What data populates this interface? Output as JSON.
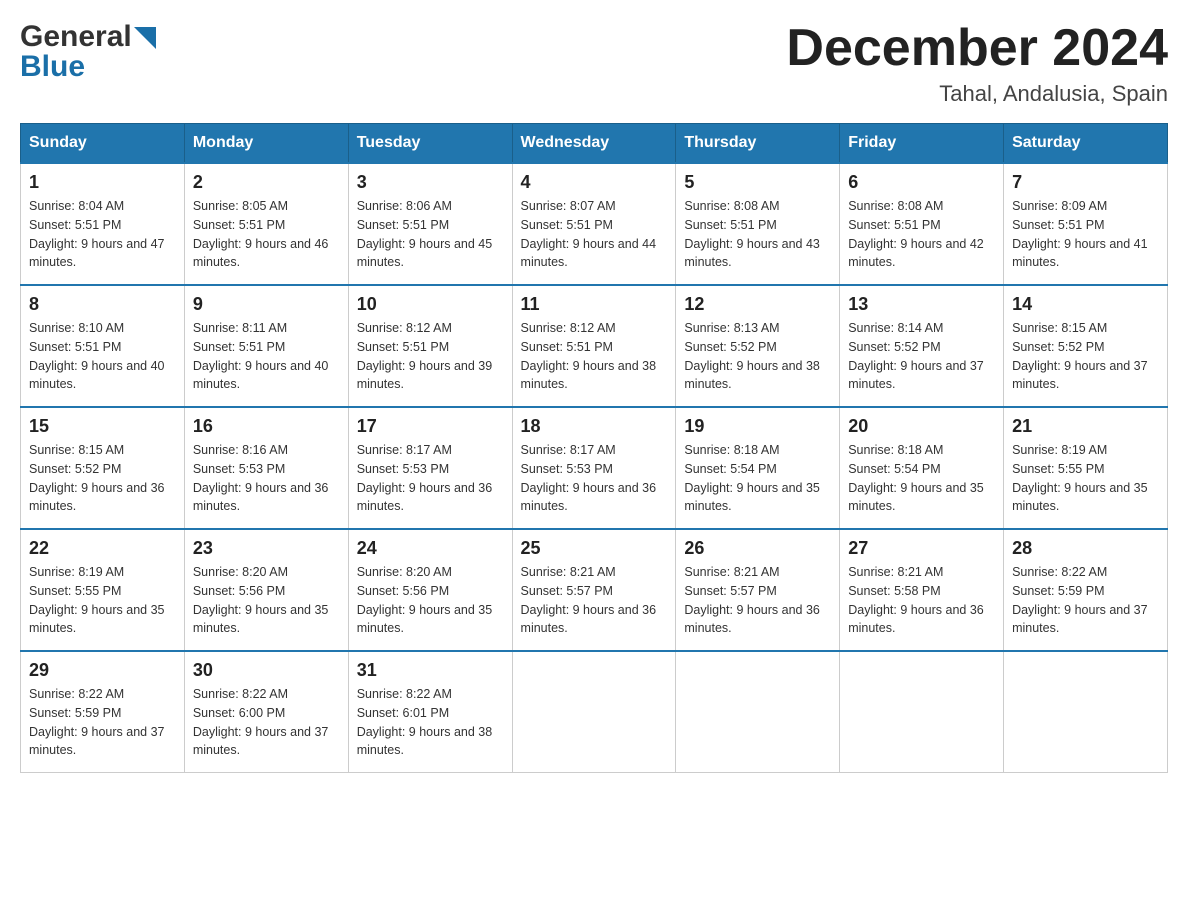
{
  "header": {
    "logo_general": "General",
    "logo_blue": "Blue",
    "month_title": "December 2024",
    "location": "Tahal, Andalusia, Spain"
  },
  "days_of_week": [
    "Sunday",
    "Monday",
    "Tuesday",
    "Wednesday",
    "Thursday",
    "Friday",
    "Saturday"
  ],
  "weeks": [
    [
      {
        "day": "1",
        "sunrise": "Sunrise: 8:04 AM",
        "sunset": "Sunset: 5:51 PM",
        "daylight": "Daylight: 9 hours and 47 minutes."
      },
      {
        "day": "2",
        "sunrise": "Sunrise: 8:05 AM",
        "sunset": "Sunset: 5:51 PM",
        "daylight": "Daylight: 9 hours and 46 minutes."
      },
      {
        "day": "3",
        "sunrise": "Sunrise: 8:06 AM",
        "sunset": "Sunset: 5:51 PM",
        "daylight": "Daylight: 9 hours and 45 minutes."
      },
      {
        "day": "4",
        "sunrise": "Sunrise: 8:07 AM",
        "sunset": "Sunset: 5:51 PM",
        "daylight": "Daylight: 9 hours and 44 minutes."
      },
      {
        "day": "5",
        "sunrise": "Sunrise: 8:08 AM",
        "sunset": "Sunset: 5:51 PM",
        "daylight": "Daylight: 9 hours and 43 minutes."
      },
      {
        "day": "6",
        "sunrise": "Sunrise: 8:08 AM",
        "sunset": "Sunset: 5:51 PM",
        "daylight": "Daylight: 9 hours and 42 minutes."
      },
      {
        "day": "7",
        "sunrise": "Sunrise: 8:09 AM",
        "sunset": "Sunset: 5:51 PM",
        "daylight": "Daylight: 9 hours and 41 minutes."
      }
    ],
    [
      {
        "day": "8",
        "sunrise": "Sunrise: 8:10 AM",
        "sunset": "Sunset: 5:51 PM",
        "daylight": "Daylight: 9 hours and 40 minutes."
      },
      {
        "day": "9",
        "sunrise": "Sunrise: 8:11 AM",
        "sunset": "Sunset: 5:51 PM",
        "daylight": "Daylight: 9 hours and 40 minutes."
      },
      {
        "day": "10",
        "sunrise": "Sunrise: 8:12 AM",
        "sunset": "Sunset: 5:51 PM",
        "daylight": "Daylight: 9 hours and 39 minutes."
      },
      {
        "day": "11",
        "sunrise": "Sunrise: 8:12 AM",
        "sunset": "Sunset: 5:51 PM",
        "daylight": "Daylight: 9 hours and 38 minutes."
      },
      {
        "day": "12",
        "sunrise": "Sunrise: 8:13 AM",
        "sunset": "Sunset: 5:52 PM",
        "daylight": "Daylight: 9 hours and 38 minutes."
      },
      {
        "day": "13",
        "sunrise": "Sunrise: 8:14 AM",
        "sunset": "Sunset: 5:52 PM",
        "daylight": "Daylight: 9 hours and 37 minutes."
      },
      {
        "day": "14",
        "sunrise": "Sunrise: 8:15 AM",
        "sunset": "Sunset: 5:52 PM",
        "daylight": "Daylight: 9 hours and 37 minutes."
      }
    ],
    [
      {
        "day": "15",
        "sunrise": "Sunrise: 8:15 AM",
        "sunset": "Sunset: 5:52 PM",
        "daylight": "Daylight: 9 hours and 36 minutes."
      },
      {
        "day": "16",
        "sunrise": "Sunrise: 8:16 AM",
        "sunset": "Sunset: 5:53 PM",
        "daylight": "Daylight: 9 hours and 36 minutes."
      },
      {
        "day": "17",
        "sunrise": "Sunrise: 8:17 AM",
        "sunset": "Sunset: 5:53 PM",
        "daylight": "Daylight: 9 hours and 36 minutes."
      },
      {
        "day": "18",
        "sunrise": "Sunrise: 8:17 AM",
        "sunset": "Sunset: 5:53 PM",
        "daylight": "Daylight: 9 hours and 36 minutes."
      },
      {
        "day": "19",
        "sunrise": "Sunrise: 8:18 AM",
        "sunset": "Sunset: 5:54 PM",
        "daylight": "Daylight: 9 hours and 35 minutes."
      },
      {
        "day": "20",
        "sunrise": "Sunrise: 8:18 AM",
        "sunset": "Sunset: 5:54 PM",
        "daylight": "Daylight: 9 hours and 35 minutes."
      },
      {
        "day": "21",
        "sunrise": "Sunrise: 8:19 AM",
        "sunset": "Sunset: 5:55 PM",
        "daylight": "Daylight: 9 hours and 35 minutes."
      }
    ],
    [
      {
        "day": "22",
        "sunrise": "Sunrise: 8:19 AM",
        "sunset": "Sunset: 5:55 PM",
        "daylight": "Daylight: 9 hours and 35 minutes."
      },
      {
        "day": "23",
        "sunrise": "Sunrise: 8:20 AM",
        "sunset": "Sunset: 5:56 PM",
        "daylight": "Daylight: 9 hours and 35 minutes."
      },
      {
        "day": "24",
        "sunrise": "Sunrise: 8:20 AM",
        "sunset": "Sunset: 5:56 PM",
        "daylight": "Daylight: 9 hours and 35 minutes."
      },
      {
        "day": "25",
        "sunrise": "Sunrise: 8:21 AM",
        "sunset": "Sunset: 5:57 PM",
        "daylight": "Daylight: 9 hours and 36 minutes."
      },
      {
        "day": "26",
        "sunrise": "Sunrise: 8:21 AM",
        "sunset": "Sunset: 5:57 PM",
        "daylight": "Daylight: 9 hours and 36 minutes."
      },
      {
        "day": "27",
        "sunrise": "Sunrise: 8:21 AM",
        "sunset": "Sunset: 5:58 PM",
        "daylight": "Daylight: 9 hours and 36 minutes."
      },
      {
        "day": "28",
        "sunrise": "Sunrise: 8:22 AM",
        "sunset": "Sunset: 5:59 PM",
        "daylight": "Daylight: 9 hours and 37 minutes."
      }
    ],
    [
      {
        "day": "29",
        "sunrise": "Sunrise: 8:22 AM",
        "sunset": "Sunset: 5:59 PM",
        "daylight": "Daylight: 9 hours and 37 minutes."
      },
      {
        "day": "30",
        "sunrise": "Sunrise: 8:22 AM",
        "sunset": "Sunset: 6:00 PM",
        "daylight": "Daylight: 9 hours and 37 minutes."
      },
      {
        "day": "31",
        "sunrise": "Sunrise: 8:22 AM",
        "sunset": "Sunset: 6:01 PM",
        "daylight": "Daylight: 9 hours and 38 minutes."
      },
      null,
      null,
      null,
      null
    ]
  ]
}
